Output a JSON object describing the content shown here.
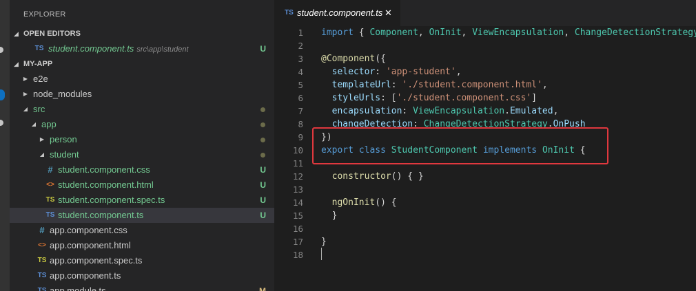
{
  "sidebar": {
    "title": "EXPLORER",
    "open_editors_label": "OPEN EDITORS",
    "open_editors": [
      {
        "icon": "TS",
        "name": "student.component.ts",
        "desc": "src\\app\\student",
        "status": "U"
      }
    ],
    "project_label": "MY-APP",
    "tree": [
      {
        "icon": "",
        "name": "e2e",
        "status": ""
      },
      {
        "icon": "",
        "name": "node_modules",
        "status": ""
      },
      {
        "icon": "",
        "name": "src",
        "status": ""
      },
      {
        "icon": "",
        "name": "app",
        "status": ""
      },
      {
        "icon": "",
        "name": "person",
        "status": ""
      },
      {
        "icon": "",
        "name": "student",
        "status": ""
      },
      {
        "icon": "#",
        "name": "student.component.css",
        "status": "U"
      },
      {
        "icon": "<>",
        "name": "student.component.html",
        "status": "U"
      },
      {
        "icon": "TS",
        "name": "student.component.spec.ts",
        "status": "U"
      },
      {
        "icon": "TS",
        "name": "student.component.ts",
        "status": "U"
      },
      {
        "icon": "#",
        "name": "app.component.css",
        "status": ""
      },
      {
        "icon": "<>",
        "name": "app.component.html",
        "status": ""
      },
      {
        "icon": "TS",
        "name": "app.component.spec.ts",
        "status": ""
      },
      {
        "icon": "TS",
        "name": "app.component.ts",
        "status": ""
      },
      {
        "icon": "TS",
        "name": "app.module.ts",
        "status": "M"
      }
    ]
  },
  "editor": {
    "tab": {
      "icon": "TS",
      "label": "student.component.ts",
      "close": "✕"
    },
    "lines": [
      {
        "n": "1"
      },
      {
        "n": "2"
      },
      {
        "n": "3"
      },
      {
        "n": "4"
      },
      {
        "n": "5"
      },
      {
        "n": "6"
      },
      {
        "n": "7"
      },
      {
        "n": "8"
      },
      {
        "n": "9"
      },
      {
        "n": "10"
      },
      {
        "n": "11"
      },
      {
        "n": "12"
      },
      {
        "n": "13"
      },
      {
        "n": "14"
      },
      {
        "n": "15"
      },
      {
        "n": "16"
      },
      {
        "n": "17"
      },
      {
        "n": "18"
      }
    ],
    "code": {
      "l1": {
        "kw": "import",
        "p1": " { ",
        "c1": "Component",
        "p2": ", ",
        "c2": "OnInit",
        "p3": ", ",
        "c3": "ViewEncapsulation",
        "p4": ", ",
        "c4": "ChangeDetectionStrategy"
      },
      "l3": {
        "dec": "@Component",
        "p": "({"
      },
      "l4": {
        "prop": "selector",
        "p": ": ",
        "str": "'app-student'",
        "e": ","
      },
      "l5": {
        "prop": "templateUrl",
        "p": ": ",
        "str": "'./student.component.html'",
        "e": ","
      },
      "l6": {
        "prop": "styleUrls",
        "p": ": [",
        "str": "'./student.component.css'",
        "e": "]"
      },
      "l7": {
        "prop": "encapsulation",
        "p": ": ",
        "c1": "ViewEncapsulation",
        "d": ".",
        "c2": "Emulated",
        "e": ","
      },
      "l8": {
        "prop": "changeDetection",
        "p": ": ",
        "c1": "ChangeDetectionStrategy",
        "d": ".",
        "c2": "OnPush"
      },
      "l9": {
        "p": "})"
      },
      "l10": {
        "kw1": "export",
        "s1": " ",
        "kw2": "class",
        "s2": " ",
        "c1": "StudentComponent",
        "s3": " ",
        "kw3": "implements",
        "s4": " ",
        "c2": "OnInit",
        "e": " {"
      },
      "l12": {
        "fn": "constructor",
        "p": "() { }"
      },
      "l14": {
        "fn": "ngOnInit",
        "p": "() {"
      },
      "l15": {
        "p": "}"
      },
      "l17": {
        "p": "}"
      }
    }
  }
}
